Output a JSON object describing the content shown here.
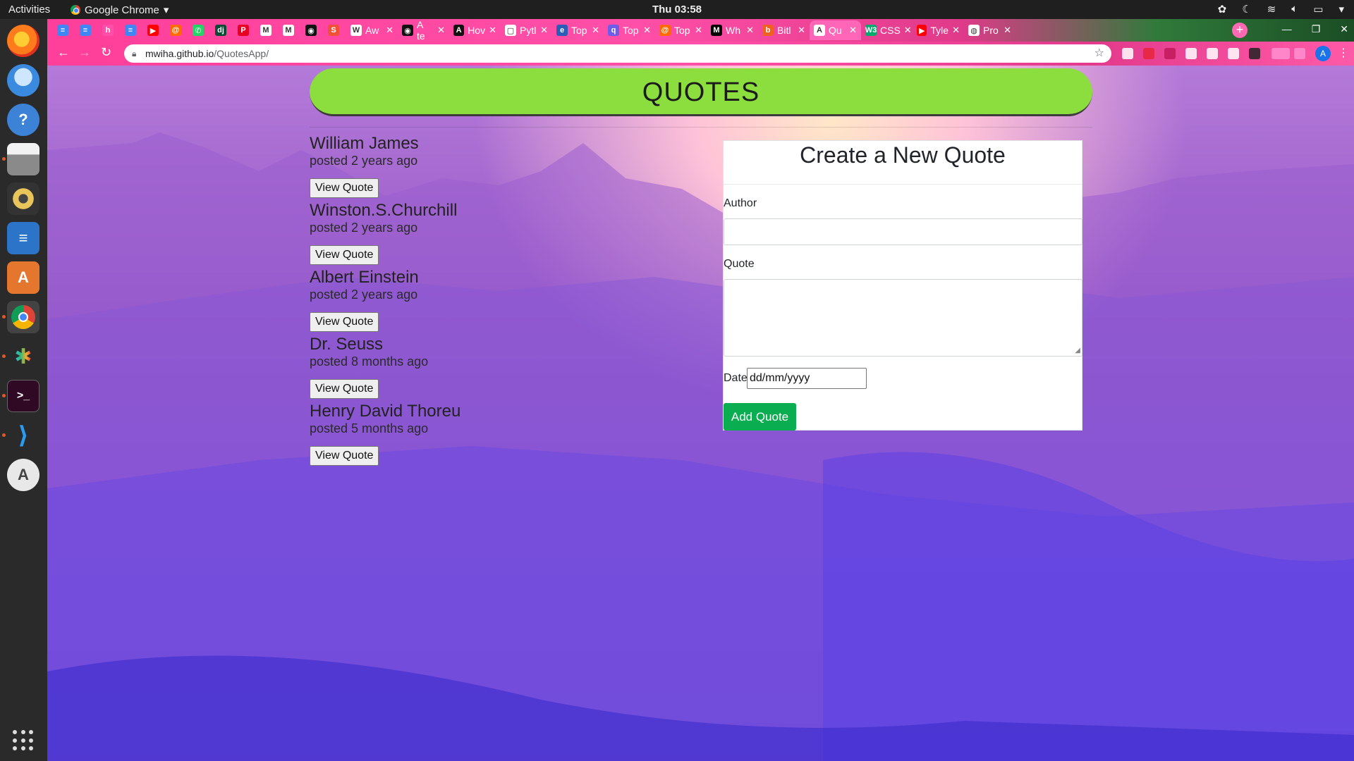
{
  "system": {
    "activities": "Activities",
    "app_name": "Google Chrome",
    "clock": "Thu 03:58"
  },
  "dock": {
    "items": [
      "firefox-icon",
      "thunderbird-icon",
      "help-icon",
      "files-icon",
      "rhythmbox-icon",
      "libreoffice-writer-icon",
      "software-center-icon",
      "chrome-icon",
      "slack-icon",
      "terminal-icon",
      "vscode-icon",
      "software-updater-icon"
    ]
  },
  "browser": {
    "tabs": [
      {
        "title": "",
        "icon": "docs-icon"
      },
      {
        "title": "",
        "icon": "docs-icon"
      },
      {
        "title": "",
        "icon": "h-icon"
      },
      {
        "title": "",
        "icon": "docs-icon"
      },
      {
        "title": "",
        "icon": "youtube-icon"
      },
      {
        "title": "",
        "icon": "swirl-icon"
      },
      {
        "title": "",
        "icon": "whatsapp-icon"
      },
      {
        "title": "",
        "icon": "django-icon"
      },
      {
        "title": "",
        "icon": "pin-icon"
      },
      {
        "title": "",
        "icon": "gmail-icon"
      },
      {
        "title": "",
        "icon": "gmail-icon"
      },
      {
        "title": "",
        "icon": "github-icon"
      },
      {
        "title": "",
        "icon": "swift-icon"
      },
      {
        "title": "Aw",
        "icon": "w-icon"
      },
      {
        "title": "A te",
        "icon": "github-icon"
      },
      {
        "title": "Hov",
        "icon": "a-icon"
      },
      {
        "title": "Pytl",
        "icon": "square-icon"
      },
      {
        "title": "Top",
        "icon": "e-icon"
      },
      {
        "title": "Top",
        "icon": "q-icon"
      },
      {
        "title": "Top",
        "icon": "swirl-icon"
      },
      {
        "title": "Wh",
        "icon": "medium-icon"
      },
      {
        "title": "Bitl",
        "icon": "bitly-icon"
      },
      {
        "title": "Qu",
        "icon": "angular-icon"
      },
      {
        "title": "CSS",
        "icon": "w3-icon"
      },
      {
        "title": "Tyle",
        "icon": "youtube-icon"
      },
      {
        "title": "Pro",
        "icon": "globe-icon"
      }
    ],
    "active_tab": 22,
    "url_host": "mwiha.github.io",
    "url_path": "/QuotesApp/",
    "profile_initial": "A"
  },
  "page": {
    "title": "QUOTES",
    "quotes": [
      {
        "author": "William James",
        "posted": "posted 2 years ago",
        "button": "View Quote"
      },
      {
        "author": "Winston.S.Churchill",
        "posted": "posted 2 years ago",
        "button": "View Quote"
      },
      {
        "author": "Albert Einstein",
        "posted": "posted 2 years ago",
        "button": "View Quote"
      },
      {
        "author": "Dr. Seuss",
        "posted": "posted 8 months ago",
        "button": "View Quote"
      },
      {
        "author": "Henry David Thoreu",
        "posted": "posted 5 months ago",
        "button": "View Quote"
      }
    ],
    "form": {
      "title": "Create a New Quote",
      "author_label": "Author",
      "author_value": "",
      "quote_label": "Quote",
      "quote_value": "",
      "date_label": "Date",
      "date_placeholder": "dd/mm/yyyy",
      "submit_label": "Add Quote"
    }
  },
  "colors": {
    "header_green": "#8cdd3e",
    "add_button_green": "#0aae51",
    "tabstrip_pink": "#ff4fa8"
  }
}
